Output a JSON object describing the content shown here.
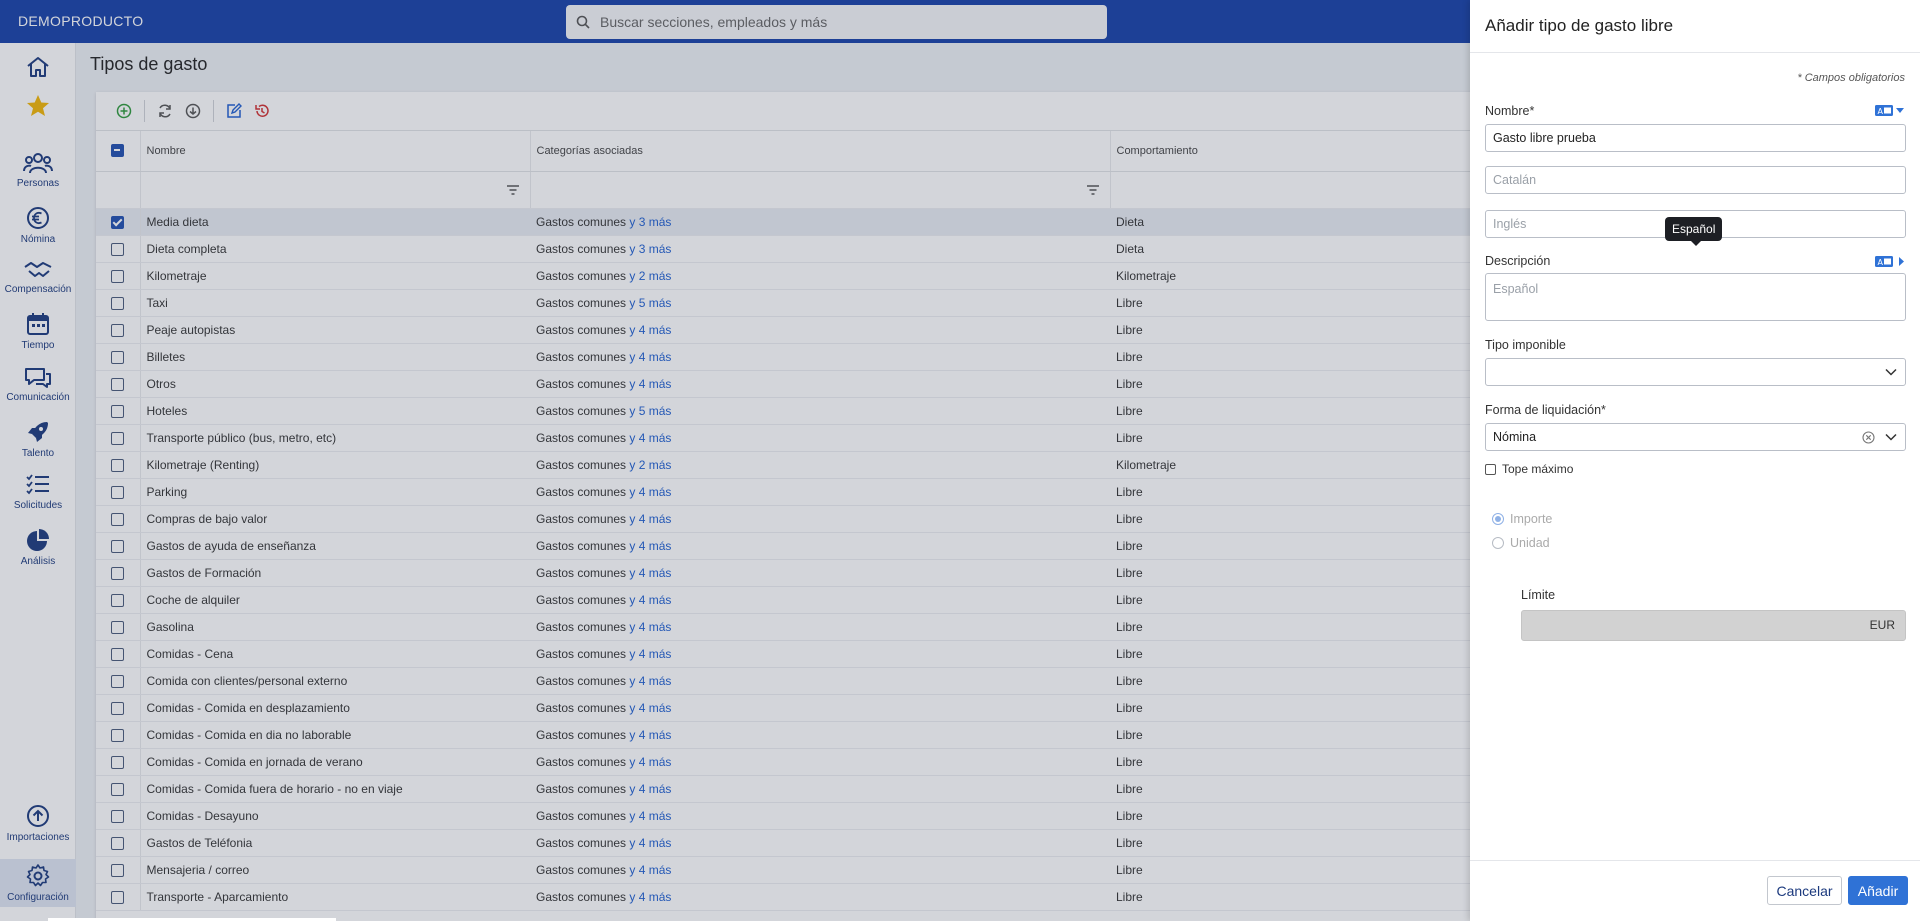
{
  "topbar": {
    "brand": "DEMOPRODUCTO",
    "search_placeholder": "Buscar secciones, empleados y más",
    "background": "#1740a8"
  },
  "sidebar": {
    "items": [
      {
        "icon": "home-icon",
        "label": ""
      },
      {
        "icon": "star-icon",
        "label": ""
      },
      {
        "icon": "people-icon",
        "label": "Personas"
      },
      {
        "icon": "euro-icon",
        "label": "Nómina"
      },
      {
        "icon": "handshake-icon",
        "label": "Compensación"
      },
      {
        "icon": "calendar-icon",
        "label": "Tiempo"
      },
      {
        "icon": "chat-icon",
        "label": "Comunicación"
      },
      {
        "icon": "rocket-icon",
        "label": "Talento"
      },
      {
        "icon": "checklist-icon",
        "label": "Solicitudes"
      },
      {
        "icon": "pie-chart-icon",
        "label": "Análisis"
      },
      {
        "icon": "upload-icon",
        "label": "Importaciones"
      },
      {
        "icon": "gear-icon",
        "label": "Configuración",
        "active": true
      }
    ]
  },
  "page": {
    "title": "Tipos de gasto",
    "columns": [
      "Nombre",
      "Categorías asociadas",
      "Comportamiento"
    ],
    "rows": [
      {
        "nombre": "Media dieta",
        "cat": "Gastos comunes",
        "more": "y 3 más",
        "comp": "Dieta",
        "checked": true
      },
      {
        "nombre": "Dieta completa",
        "cat": "Gastos comunes",
        "more": "y 3 más",
        "comp": "Dieta"
      },
      {
        "nombre": "Kilometraje",
        "cat": "Gastos comunes",
        "more": "y 2 más",
        "comp": "Kilometraje"
      },
      {
        "nombre": "Taxi",
        "cat": "Gastos comunes",
        "more": "y 5 más",
        "comp": "Libre"
      },
      {
        "nombre": "Peaje autopistas",
        "cat": "Gastos comunes",
        "more": "y 4 más",
        "comp": "Libre"
      },
      {
        "nombre": "Billetes",
        "cat": "Gastos comunes",
        "more": "y 4 más",
        "comp": "Libre"
      },
      {
        "nombre": "Otros",
        "cat": "Gastos comunes",
        "more": "y 4 más",
        "comp": "Libre"
      },
      {
        "nombre": "Hoteles",
        "cat": "Gastos comunes",
        "more": "y 5 más",
        "comp": "Libre"
      },
      {
        "nombre": "Transporte público (bus, metro, etc)",
        "cat": "Gastos comunes",
        "more": "y 4 más",
        "comp": "Libre"
      },
      {
        "nombre": "Kilometraje (Renting)",
        "cat": "Gastos comunes",
        "more": "y 2 más",
        "comp": "Kilometraje"
      },
      {
        "nombre": "Parking",
        "cat": "Gastos comunes",
        "more": "y 4 más",
        "comp": "Libre"
      },
      {
        "nombre": "Compras de bajo valor",
        "cat": "Gastos comunes",
        "more": "y 4 más",
        "comp": "Libre"
      },
      {
        "nombre": "Gastos de ayuda de enseñanza",
        "cat": "Gastos comunes",
        "more": "y 4 más",
        "comp": "Libre"
      },
      {
        "nombre": "Gastos de Formación",
        "cat": "Gastos comunes",
        "more": "y 4 más",
        "comp": "Libre"
      },
      {
        "nombre": "Coche de alquiler",
        "cat": "Gastos comunes",
        "more": "y 4 más",
        "comp": "Libre"
      },
      {
        "nombre": "Gasolina",
        "cat": "Gastos comunes",
        "more": "y 4 más",
        "comp": "Libre"
      },
      {
        "nombre": "Comidas - Cena",
        "cat": "Gastos comunes",
        "more": "y 4 más",
        "comp": "Libre"
      },
      {
        "nombre": "Comida con clientes/personal externo",
        "cat": "Gastos comunes",
        "more": "y 4 más",
        "comp": "Libre"
      },
      {
        "nombre": "Comidas - Comida en desplazamiento",
        "cat": "Gastos comunes",
        "more": "y 4 más",
        "comp": "Libre"
      },
      {
        "nombre": "Comidas - Comida en dia no laborable",
        "cat": "Gastos comunes",
        "more": "y 4 más",
        "comp": "Libre"
      },
      {
        "nombre": "Comidas - Comida en jornada de verano",
        "cat": "Gastos comunes",
        "more": "y 4 más",
        "comp": "Libre"
      },
      {
        "nombre": "Comidas - Comida fuera de horario - no en viaje",
        "cat": "Gastos comunes",
        "more": "y 4 más",
        "comp": "Libre"
      },
      {
        "nombre": "Comidas - Desayuno",
        "cat": "Gastos comunes",
        "more": "y 4 más",
        "comp": "Libre"
      },
      {
        "nombre": "Gastos de Teléfonia",
        "cat": "Gastos comunes",
        "more": "y 4 más",
        "comp": "Libre"
      },
      {
        "nombre": "Mensajeria / correo",
        "cat": "Gastos comunes",
        "more": "y 4 más",
        "comp": "Libre"
      },
      {
        "nombre": "Transporte - Aparcamiento",
        "cat": "Gastos comunes",
        "more": "y 4 más",
        "comp": "Libre"
      }
    ]
  },
  "drawer": {
    "title": "Añadir tipo de gasto libre",
    "required_note": "* Campos obligatorios",
    "nombre_label": "Nombre*",
    "nombre_value": "Gasto libre prueba",
    "catalan_placeholder": "Catalán",
    "ingles_placeholder": "Inglés",
    "tooltip": "Español",
    "descripcion_label": "Descripción",
    "descripcion_placeholder": "Español",
    "tipo_imponible_label": "Tipo imponible",
    "tipo_imponible_value": "",
    "forma_label": "Forma de liquidación*",
    "forma_value": "Nómina",
    "tope_label": "Tope máximo",
    "radio_importe": "Importe",
    "radio_unidad": "Unidad",
    "limite_label": "Límite",
    "limite_unit": "EUR",
    "cancel": "Cancelar",
    "add": "Añadir",
    "accent": "#2f72d6"
  }
}
